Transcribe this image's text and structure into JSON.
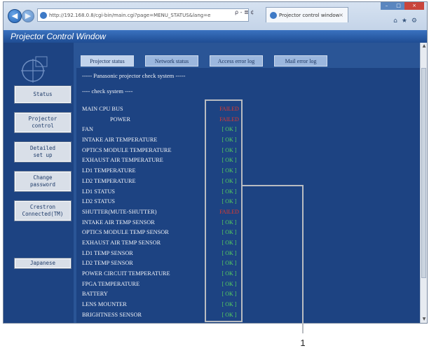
{
  "browser": {
    "address": "http://192.168.0.8/cgi-bin/main.cgi?page=MENU_STATUS&lang=e",
    "tab_title": "Projector control window",
    "tab_close": "×",
    "addr_tools": "ρ - ≣ ¢",
    "window_controls": {
      "minimize": "–",
      "maximize": "□",
      "close": "×"
    },
    "chrome_icons": "⌂★⚙"
  },
  "page_title": "Projector Control Window",
  "sidebar": {
    "buttons": [
      {
        "label": "Status"
      },
      {
        "label": "Projector\ncontrol"
      },
      {
        "label": "Detailed\nset up"
      },
      {
        "label": "Change\npassword"
      },
      {
        "label": "Crestron\nConnected(TM)"
      },
      {
        "label": "Japanese"
      }
    ]
  },
  "tabs": [
    {
      "label": "Projector status"
    },
    {
      "label": "Network status"
    },
    {
      "label": "Access error log"
    },
    {
      "label": "Mail error log"
    }
  ],
  "panel": {
    "heading": "----- Panasonic projector check system -----",
    "subheading": "---- check system ----",
    "rows": [
      {
        "label": "MAIN CPU BUS",
        "status": "FAILED",
        "state": "failed",
        "indent": false
      },
      {
        "label": "POWER",
        "status": "FAILED",
        "state": "failed",
        "indent": true
      },
      {
        "label": "FAN",
        "status": "[ OK ]",
        "state": "ok",
        "indent": false
      },
      {
        "label": "INTAKE AIR TEMPERATURE",
        "status": "[ OK ]",
        "state": "ok",
        "indent": false
      },
      {
        "label": "OPTICS MODULE TEMPERATURE",
        "status": "[ OK ]",
        "state": "ok",
        "indent": false
      },
      {
        "label": "EXHAUST AIR TEMPERATURE",
        "status": "[ OK ]",
        "state": "ok",
        "indent": false
      },
      {
        "label": "LD1 TEMPERATURE",
        "status": "[ OK ]",
        "state": "ok",
        "indent": false
      },
      {
        "label": "LD2 TEMPERATURE",
        "status": "[ OK ]",
        "state": "ok",
        "indent": false
      },
      {
        "label": "LD1 STATUS",
        "status": "[ OK ]",
        "state": "ok",
        "indent": false
      },
      {
        "label": "LD2 STATUS",
        "status": "[ OK ]",
        "state": "ok",
        "indent": false
      },
      {
        "label": "SHUTTER(MUTE-SHUTTER)",
        "status": "FAILED",
        "state": "failed",
        "indent": false
      },
      {
        "label": "INTAKE AIR TEMP SENSOR",
        "status": "[ OK ]",
        "state": "ok",
        "indent": false
      },
      {
        "label": "OPTICS MODULE TEMP SENSOR",
        "status": "[ OK ]",
        "state": "ok",
        "indent": false
      },
      {
        "label": "EXHAUST AIR TEMP SENSOR",
        "status": "[ OK ]",
        "state": "ok",
        "indent": false
      },
      {
        "label": "LD1 TEMP SENSOR",
        "status": "[ OK ]",
        "state": "ok",
        "indent": false
      },
      {
        "label": "LD2 TEMP SENSOR",
        "status": "[ OK ]",
        "state": "ok",
        "indent": false
      },
      {
        "label": "POWER CIRCUIT TEMPERATURE",
        "status": "[ OK ]",
        "state": "ok",
        "indent": false
      },
      {
        "label": "FPGA TEMPERATURE",
        "status": "[ OK ]",
        "state": "ok",
        "indent": false
      },
      {
        "label": "BATTERY",
        "status": "[ OK ]",
        "state": "ok",
        "indent": false
      },
      {
        "label": "LENS MOUNTER",
        "status": "[ OK ]",
        "state": "ok",
        "indent": false
      },
      {
        "label": "BRIGHTNESS SENSOR",
        "status": "[ OK ]",
        "state": "ok",
        "indent": false
      }
    ]
  },
  "callout": {
    "number": "1"
  },
  "colors": {
    "ok": "#57d15e",
    "failed": "#e23a2e",
    "panel_bg": "#1d4382",
    "title_bar": "#2a5aa8"
  },
  "icons": {
    "back": "back-arrow-icon",
    "forward": "forward-arrow-icon",
    "logo": "panasonic-logo-icon"
  }
}
